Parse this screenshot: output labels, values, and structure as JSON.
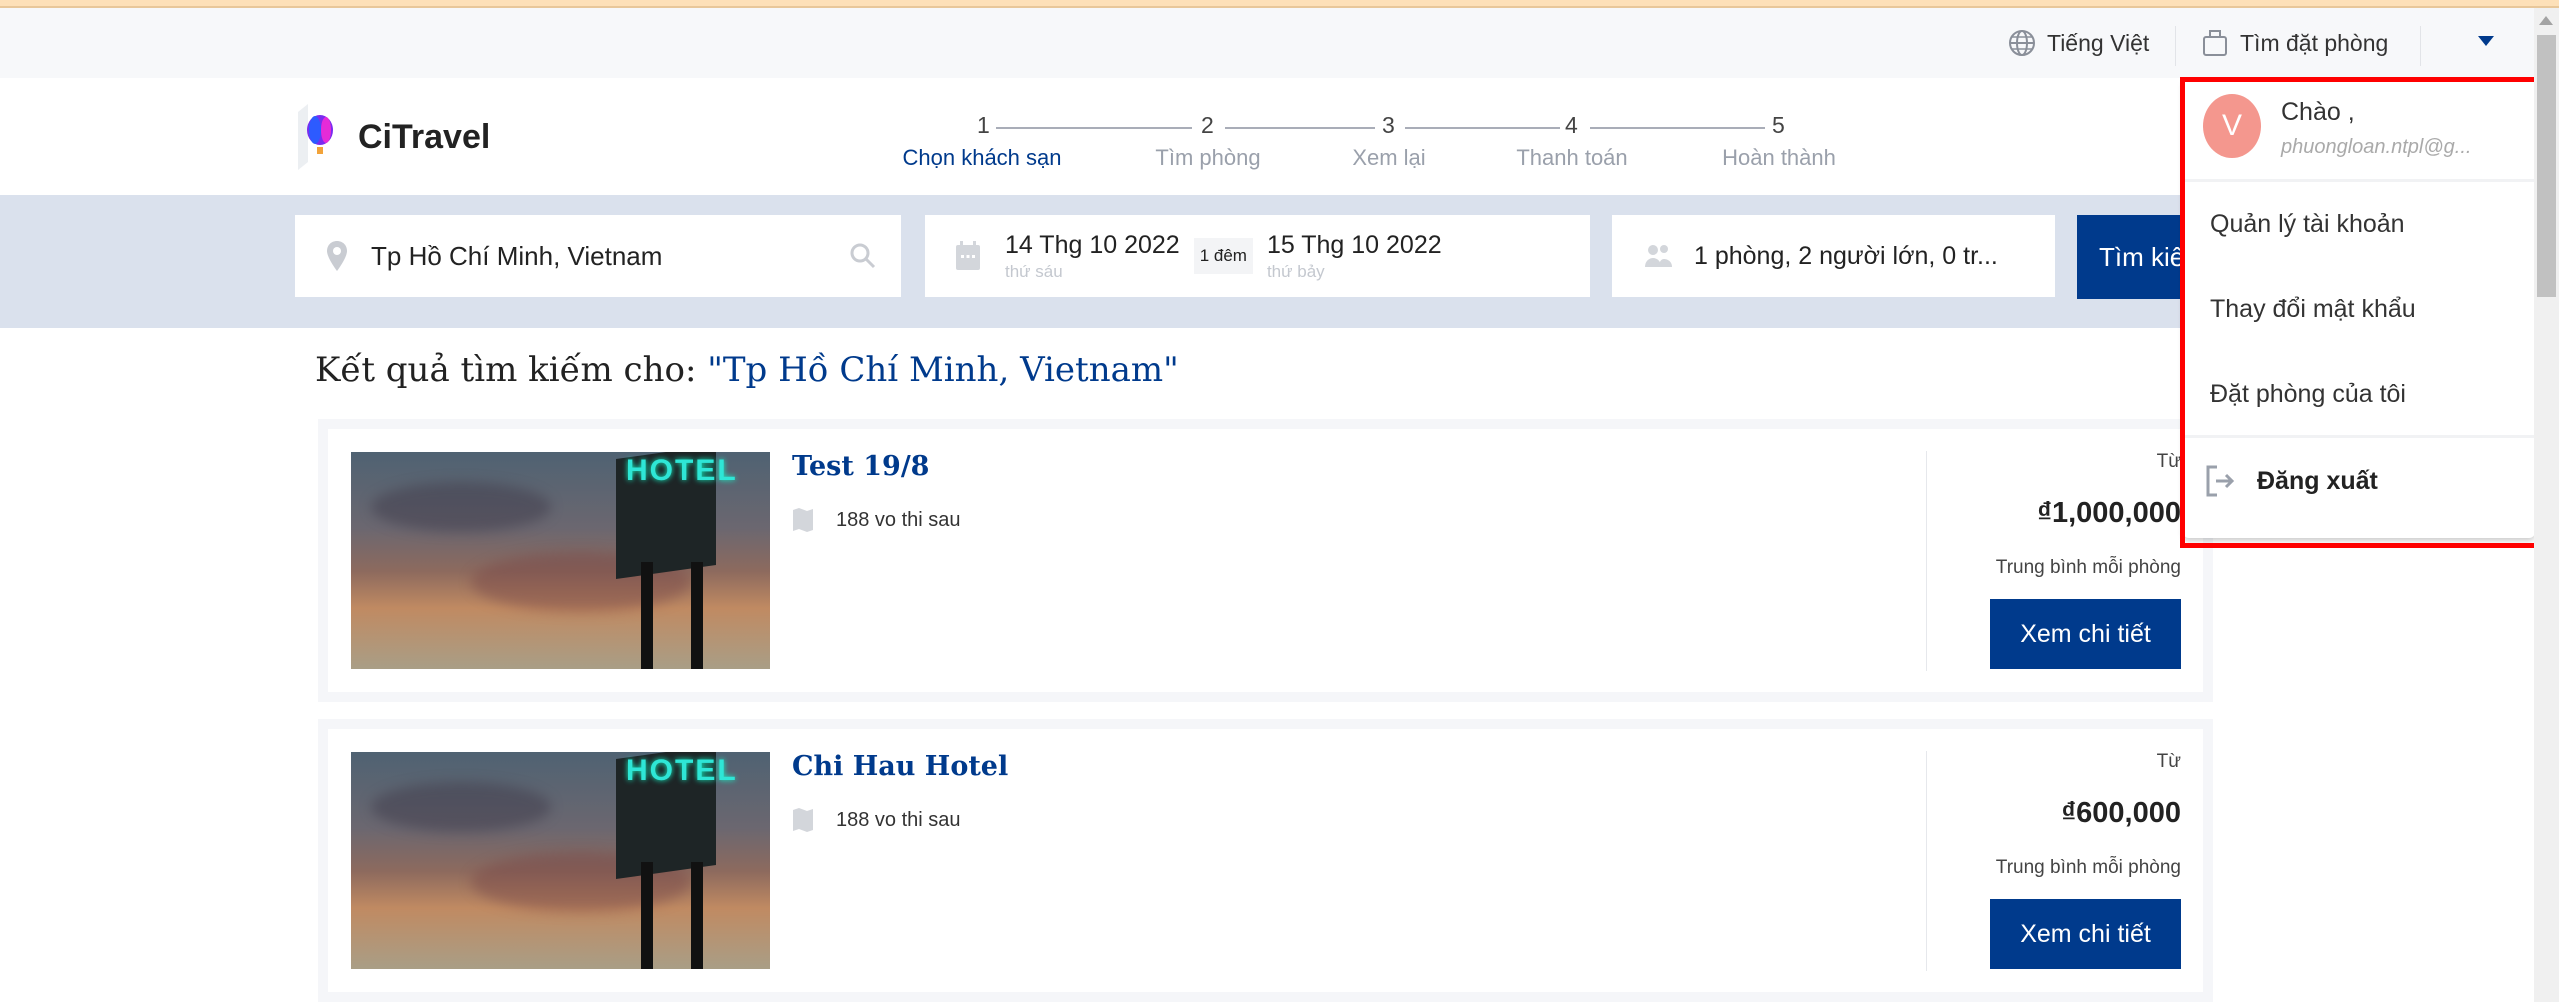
{
  "topbar": {
    "language": "Tiếng Việt",
    "find_booking": "Tìm đặt phòng"
  },
  "brand": {
    "name": "CiTravel"
  },
  "steps": [
    {
      "num": "1",
      "label": "Chọn khách sạn",
      "active": true
    },
    {
      "num": "2",
      "label": "Tìm phòng",
      "active": false
    },
    {
      "num": "3",
      "label": "Xem lại",
      "active": false
    },
    {
      "num": "4",
      "label": "Thanh toán",
      "active": false
    },
    {
      "num": "5",
      "label": "Hoàn thành",
      "active": false
    }
  ],
  "search": {
    "location": "Tp Hồ Chí Minh, Vietnam",
    "checkin": "14 Thg 10 2022",
    "checkin_day": "thứ sáu",
    "nights": "1 đêm",
    "checkout": "15 Thg 10 2022",
    "checkout_day": "thứ bảy",
    "guests": "1 phòng, 2 người lớn, 0 tr...",
    "button": "Tìm kiếm"
  },
  "results": {
    "prefix": "Kết quả tìm kiếm cho: ",
    "query": "\"Tp Hồ Chí Minh, Vietnam\"",
    "hotels": [
      {
        "name": "Test 19/8",
        "address": "188 vo thi sau",
        "from": "Từ",
        "price": "₫1,000,000",
        "avg": "Trung bình mỗi phòng",
        "button": "Xem chi tiết",
        "image_text": "HOTEL"
      },
      {
        "name": "Chi Hau Hotel",
        "address": "188 vo thi sau",
        "from": "Từ",
        "price": "₫600,000",
        "avg": "Trung bình mỗi phòng",
        "button": "Xem chi tiết",
        "image_text": "HOTEL"
      }
    ]
  },
  "user_menu": {
    "avatar_letter": "V",
    "greeting": "Chào ,",
    "email": "phuongloan.ntpl@g...",
    "items": [
      "Quản lý tài khoản",
      "Thay đổi mật khẩu",
      "Đặt phòng của tôi"
    ],
    "logout": "Đăng xuất"
  },
  "colors": {
    "primary": "#003a8c",
    "avatar": "#f4978e",
    "highlight": "#ff0000"
  }
}
